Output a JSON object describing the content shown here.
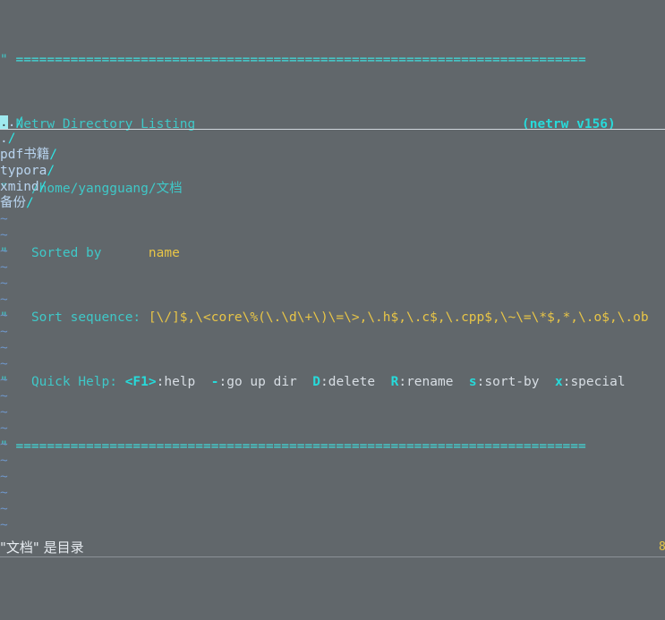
{
  "app": {
    "name": "vim-netrw",
    "window_title": "Netrw Directory Listing"
  },
  "colors": {
    "background": "#61676b",
    "banner_cyan": "#3fc8c8",
    "separator_cyan": "#3fdede",
    "sort_value_yellow": "#e8c547",
    "directory_name": "#b9d4ef",
    "trailing_slash": "#2fe6e6",
    "tilde_filler": "#6f96c8",
    "cursor_block": "#9fe9ef",
    "status_text": "#e6ebf0"
  },
  "banner": {
    "comment_char": "\"",
    "separator": "=========================================================================",
    "title": "Netrw Directory Listing",
    "version": "(netrw v156)",
    "path": "/home/yangguang/文档",
    "sorted_by_label": "Sorted by",
    "sorted_by_value": "name",
    "sort_sequence_label": "Sort sequence:",
    "sort_sequence_value": "[\\/]$,\\<core\\%(\\.\\d\\+\\)\\=\\>,\\.h$,\\.c$,\\.cpp$,\\~\\=\\*$,*,\\.o$,\\.ob",
    "quick_help_label": "Quick Help:",
    "quick_help_items": [
      {
        "key": "<F1>",
        "sep": ":",
        "action": "help"
      },
      {
        "key": "-",
        "sep": ":",
        "action": "go up dir"
      },
      {
        "key": "D",
        "sep": ":",
        "action": "delete"
      },
      {
        "key": "R",
        "sep": ":",
        "action": "rename"
      },
      {
        "key": "s",
        "sep": ":",
        "action": "sort-by"
      },
      {
        "key": "x",
        "sep": ":",
        "action": "special"
      }
    ]
  },
  "listing": {
    "entries": [
      {
        "name": "..",
        "slash": "/",
        "selected": true
      },
      {
        "name": ".",
        "slash": "/",
        "selected": false
      },
      {
        "name": "pdf书籍",
        "slash": "/",
        "selected": false
      },
      {
        "name": "typora",
        "slash": "/",
        "selected": false
      },
      {
        "name": "xmind",
        "slash": "/",
        "selected": false
      },
      {
        "name": "备份",
        "slash": "/",
        "selected": false
      }
    ]
  },
  "filler": {
    "char": "~",
    "count": 20
  },
  "statusline": {
    "message": "\"文档\" 是目录",
    "ruler": "8"
  }
}
